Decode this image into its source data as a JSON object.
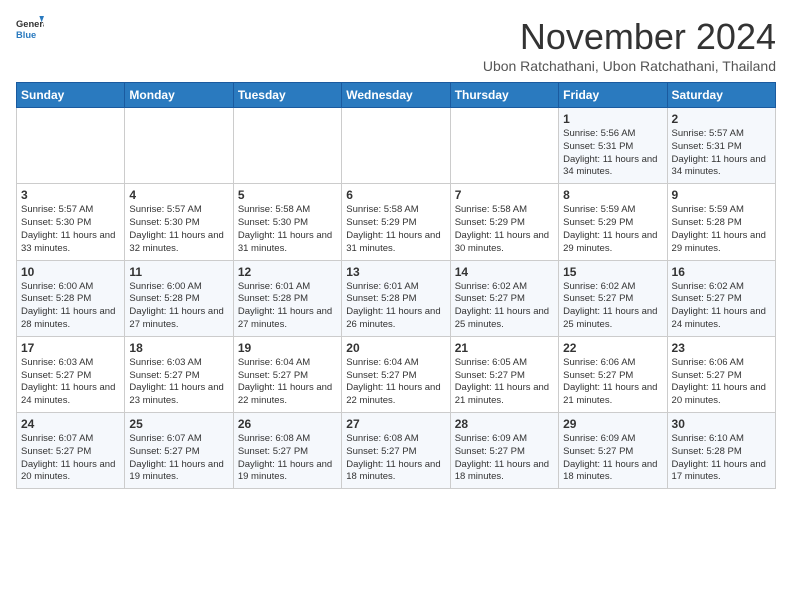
{
  "logo": {
    "line1": "General",
    "line2": "Blue"
  },
  "header": {
    "month": "November 2024",
    "location": "Ubon Ratchathani, Ubon Ratchathani, Thailand"
  },
  "weekdays": [
    "Sunday",
    "Monday",
    "Tuesday",
    "Wednesday",
    "Thursday",
    "Friday",
    "Saturday"
  ],
  "weeks": [
    [
      {
        "day": "",
        "info": ""
      },
      {
        "day": "",
        "info": ""
      },
      {
        "day": "",
        "info": ""
      },
      {
        "day": "",
        "info": ""
      },
      {
        "day": "",
        "info": ""
      },
      {
        "day": "1",
        "info": "Sunrise: 5:56 AM\nSunset: 5:31 PM\nDaylight: 11 hours and 34 minutes."
      },
      {
        "day": "2",
        "info": "Sunrise: 5:57 AM\nSunset: 5:31 PM\nDaylight: 11 hours and 34 minutes."
      }
    ],
    [
      {
        "day": "3",
        "info": "Sunrise: 5:57 AM\nSunset: 5:30 PM\nDaylight: 11 hours and 33 minutes."
      },
      {
        "day": "4",
        "info": "Sunrise: 5:57 AM\nSunset: 5:30 PM\nDaylight: 11 hours and 32 minutes."
      },
      {
        "day": "5",
        "info": "Sunrise: 5:58 AM\nSunset: 5:30 PM\nDaylight: 11 hours and 31 minutes."
      },
      {
        "day": "6",
        "info": "Sunrise: 5:58 AM\nSunset: 5:29 PM\nDaylight: 11 hours and 31 minutes."
      },
      {
        "day": "7",
        "info": "Sunrise: 5:58 AM\nSunset: 5:29 PM\nDaylight: 11 hours and 30 minutes."
      },
      {
        "day": "8",
        "info": "Sunrise: 5:59 AM\nSunset: 5:29 PM\nDaylight: 11 hours and 29 minutes."
      },
      {
        "day": "9",
        "info": "Sunrise: 5:59 AM\nSunset: 5:28 PM\nDaylight: 11 hours and 29 minutes."
      }
    ],
    [
      {
        "day": "10",
        "info": "Sunrise: 6:00 AM\nSunset: 5:28 PM\nDaylight: 11 hours and 28 minutes."
      },
      {
        "day": "11",
        "info": "Sunrise: 6:00 AM\nSunset: 5:28 PM\nDaylight: 11 hours and 27 minutes."
      },
      {
        "day": "12",
        "info": "Sunrise: 6:01 AM\nSunset: 5:28 PM\nDaylight: 11 hours and 27 minutes."
      },
      {
        "day": "13",
        "info": "Sunrise: 6:01 AM\nSunset: 5:28 PM\nDaylight: 11 hours and 26 minutes."
      },
      {
        "day": "14",
        "info": "Sunrise: 6:02 AM\nSunset: 5:27 PM\nDaylight: 11 hours and 25 minutes."
      },
      {
        "day": "15",
        "info": "Sunrise: 6:02 AM\nSunset: 5:27 PM\nDaylight: 11 hours and 25 minutes."
      },
      {
        "day": "16",
        "info": "Sunrise: 6:02 AM\nSunset: 5:27 PM\nDaylight: 11 hours and 24 minutes."
      }
    ],
    [
      {
        "day": "17",
        "info": "Sunrise: 6:03 AM\nSunset: 5:27 PM\nDaylight: 11 hours and 24 minutes."
      },
      {
        "day": "18",
        "info": "Sunrise: 6:03 AM\nSunset: 5:27 PM\nDaylight: 11 hours and 23 minutes."
      },
      {
        "day": "19",
        "info": "Sunrise: 6:04 AM\nSunset: 5:27 PM\nDaylight: 11 hours and 22 minutes."
      },
      {
        "day": "20",
        "info": "Sunrise: 6:04 AM\nSunset: 5:27 PM\nDaylight: 11 hours and 22 minutes."
      },
      {
        "day": "21",
        "info": "Sunrise: 6:05 AM\nSunset: 5:27 PM\nDaylight: 11 hours and 21 minutes."
      },
      {
        "day": "22",
        "info": "Sunrise: 6:06 AM\nSunset: 5:27 PM\nDaylight: 11 hours and 21 minutes."
      },
      {
        "day": "23",
        "info": "Sunrise: 6:06 AM\nSunset: 5:27 PM\nDaylight: 11 hours and 20 minutes."
      }
    ],
    [
      {
        "day": "24",
        "info": "Sunrise: 6:07 AM\nSunset: 5:27 PM\nDaylight: 11 hours and 20 minutes."
      },
      {
        "day": "25",
        "info": "Sunrise: 6:07 AM\nSunset: 5:27 PM\nDaylight: 11 hours and 19 minutes."
      },
      {
        "day": "26",
        "info": "Sunrise: 6:08 AM\nSunset: 5:27 PM\nDaylight: 11 hours and 19 minutes."
      },
      {
        "day": "27",
        "info": "Sunrise: 6:08 AM\nSunset: 5:27 PM\nDaylight: 11 hours and 18 minutes."
      },
      {
        "day": "28",
        "info": "Sunrise: 6:09 AM\nSunset: 5:27 PM\nDaylight: 11 hours and 18 minutes."
      },
      {
        "day": "29",
        "info": "Sunrise: 6:09 AM\nSunset: 5:27 PM\nDaylight: 11 hours and 18 minutes."
      },
      {
        "day": "30",
        "info": "Sunrise: 6:10 AM\nSunset: 5:28 PM\nDaylight: 11 hours and 17 minutes."
      }
    ]
  ]
}
